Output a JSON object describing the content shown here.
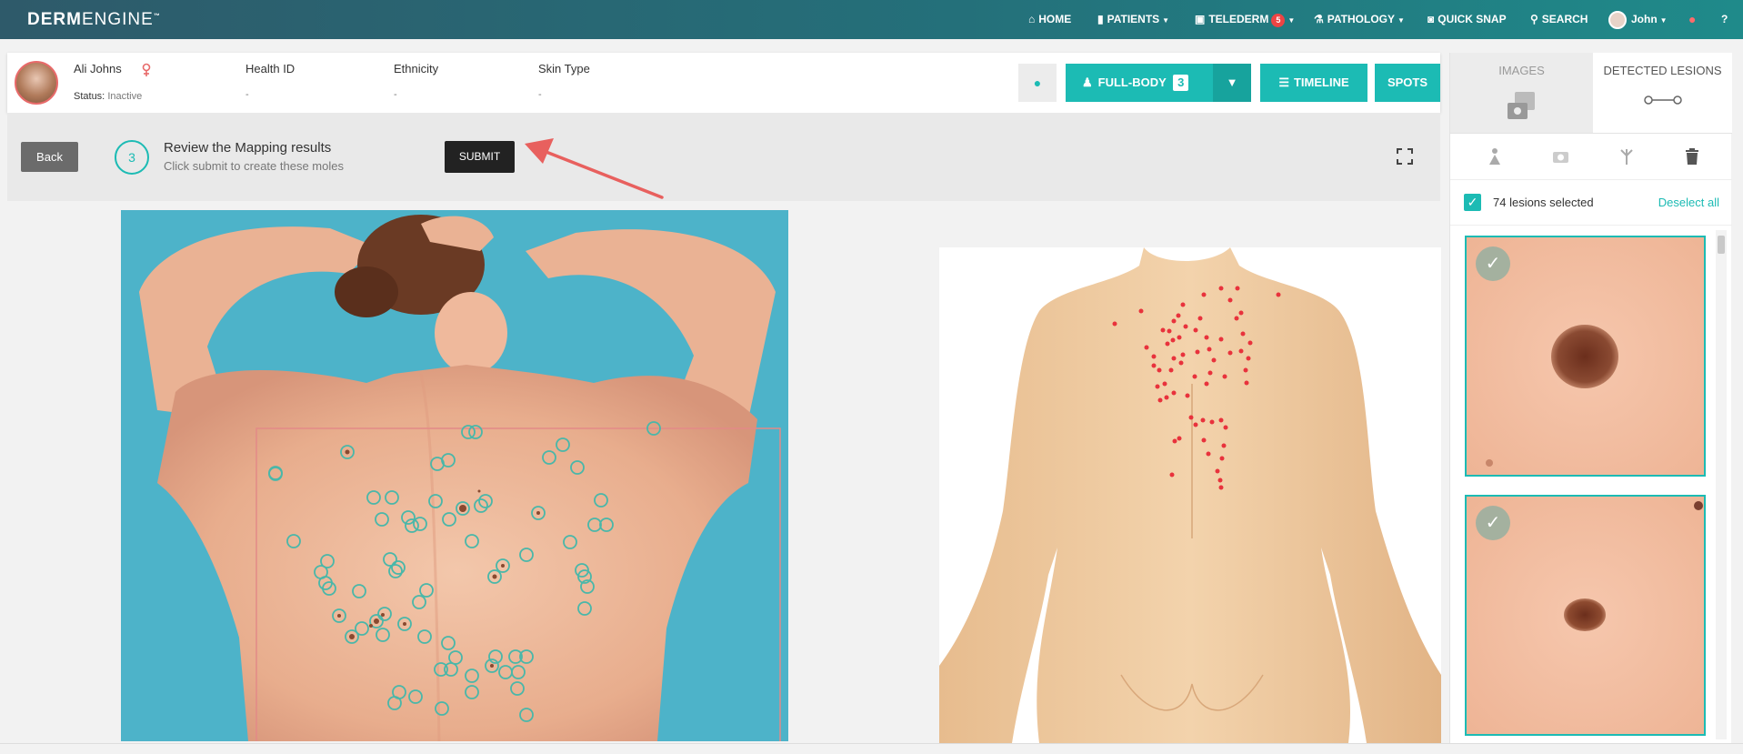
{
  "nav": {
    "logo_bold": "DERM",
    "logo_thin": "ENGINE",
    "logo_tm": "™",
    "home": "HOME",
    "patients": "PATIENTS",
    "telederm": "TELEDERM",
    "telederm_badge": "5",
    "pathology": "PATHOLOGY",
    "quick_snap": "QUICK SNAP",
    "search": "SEARCH",
    "user": "John"
  },
  "patient": {
    "name": "Ali Johns",
    "status_label": "Status:",
    "status_value": "Inactive",
    "health_id_label": "Health ID",
    "health_id_value": "-",
    "ethnicity_label": "Ethnicity",
    "ethnicity_value": "-",
    "skin_type_label": "Skin Type",
    "skin_type_value": "-"
  },
  "actions": {
    "full_body": "FULL-BODY",
    "full_body_count": "3",
    "timeline": "TIMELINE",
    "spots": "SPOTS"
  },
  "step": {
    "back": "Back",
    "number": "3",
    "title": "Review the Mapping results",
    "subtitle": "Click submit to create these moles",
    "submit": "SUBMIT"
  },
  "right_panel": {
    "tab_images": "IMAGES",
    "tab_detected": "DETECTED LESIONS",
    "selected_text": "74 lesions selected",
    "deselect_all": "Deselect all"
  },
  "colors": {
    "accent": "#1cbbb4",
    "model_dot": "#e8323c",
    "annotation_arrow": "#e8605e"
  }
}
